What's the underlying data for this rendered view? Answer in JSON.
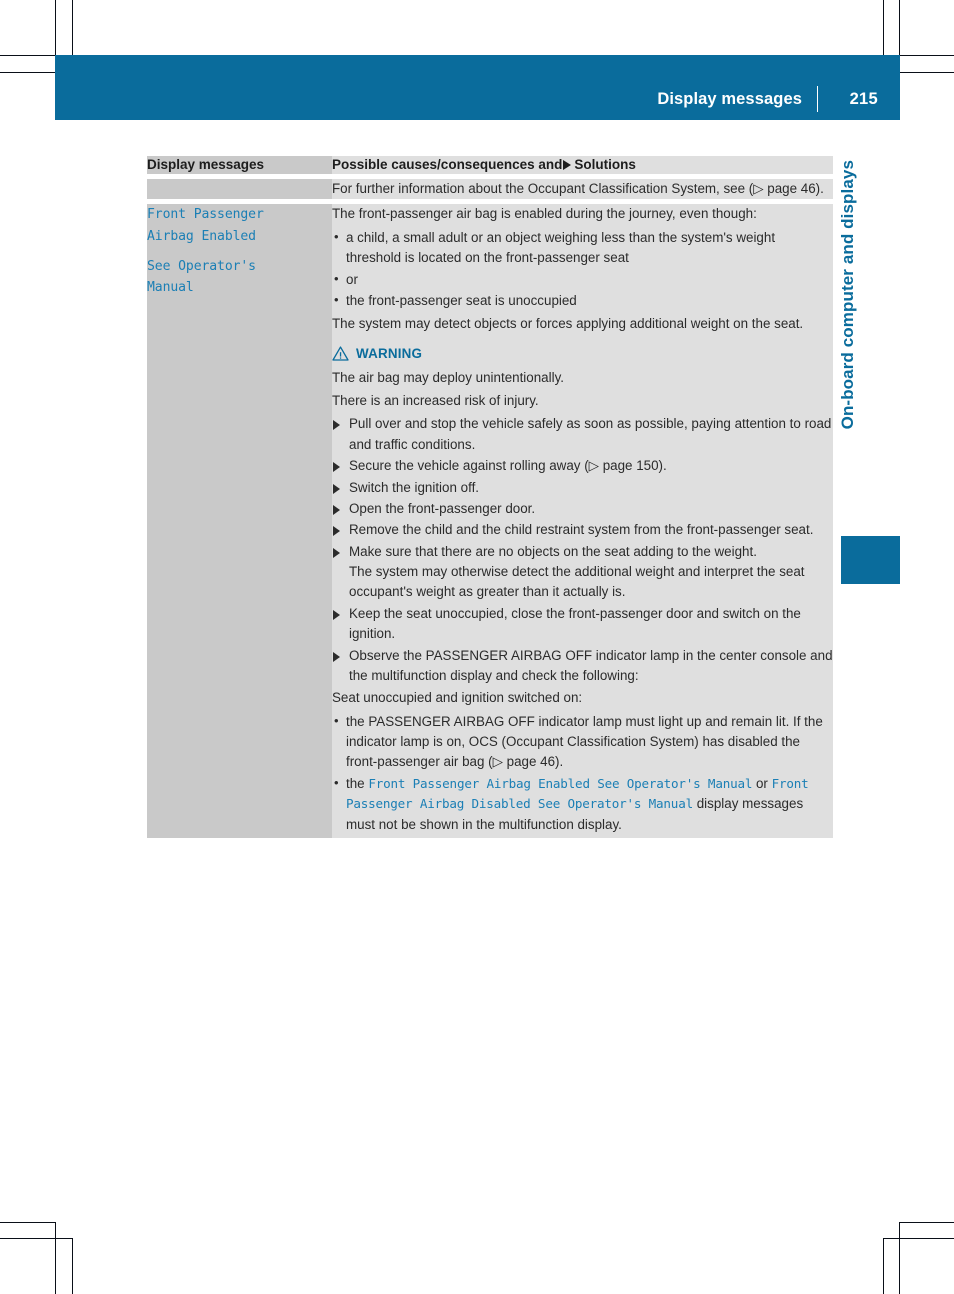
{
  "header": {
    "title": "Display messages",
    "page_number": "215"
  },
  "chapter_tab": {
    "label": "On-board computer and displays"
  },
  "table": {
    "headers": {
      "left": "Display messages",
      "right_before_icon": "Possible causes/consequences and",
      "right_after_icon": "Solutions"
    },
    "row1": {
      "right_text": "For further information about the Occupant Classification System, see (▷ page 46)."
    },
    "row2": {
      "message_line1": "Front Passenger",
      "message_line2": "Airbag Enabled",
      "message_line3": "See Operator's",
      "message_line4": "Manual",
      "intro": "The front-passenger air bag is enabled during the journey, even though:",
      "bullets": [
        "a child, a small adult or an object weighing less than the system's weight threshold is located on the front-passenger seat",
        "or",
        "the front-passenger seat is unoccupied"
      ],
      "after_bullets": "The system may detect objects or forces applying additional weight on the seat.",
      "warning": {
        "label": "WARNING",
        "lines": [
          "The air bag may deploy unintentionally.",
          "There is an increased risk of injury."
        ],
        "steps": [
          "Pull over and stop the vehicle safely as soon as possible, paying attention to road and traffic conditions.",
          "Secure the vehicle against rolling away (▷ page 150).",
          "Switch the ignition off.",
          "Open the front-passenger door.",
          "Remove the child and the child restraint system from the front-passenger seat.",
          "Make sure that there are no objects on the seat adding to the weight.",
          "Keep the seat unoccupied, close the front-passenger door and switch on the ignition.",
          "Observe the PASSENGER AIRBAG OFF indicator lamp in the center console and the multifunction display and check the following:"
        ],
        "step6_subnote": "The system may otherwise detect the additional weight and interpret the seat occupant's weight as greater than it actually is."
      },
      "check_heading": "Seat unoccupied and ignition switched on:",
      "check_bullet1": "the PASSENGER AIRBAG OFF indicator lamp must light up and remain lit. If the indicator lamp is on, OCS (Occupant Classification System) has disabled the front-passenger air bag (▷ page 46).",
      "check_bullet2": {
        "lead": "the",
        "msg_a": "Front Passenger Airbag Enabled See Operator's Manual",
        "conjunction": "or",
        "msg_b": "Front Passenger Airbag Disabled See Operator's Manual",
        "tail": "display messages must not be shown in the multifunction display."
      }
    }
  },
  "page_reference_glyph": "▷",
  "colors": {
    "brand_blue": "#0a6c9c",
    "message_blue": "#1b7fb5",
    "col_left_bg": "#c9c9c9",
    "col_right_bg": "#dfdfdf",
    "text": "#2b2b2b"
  }
}
